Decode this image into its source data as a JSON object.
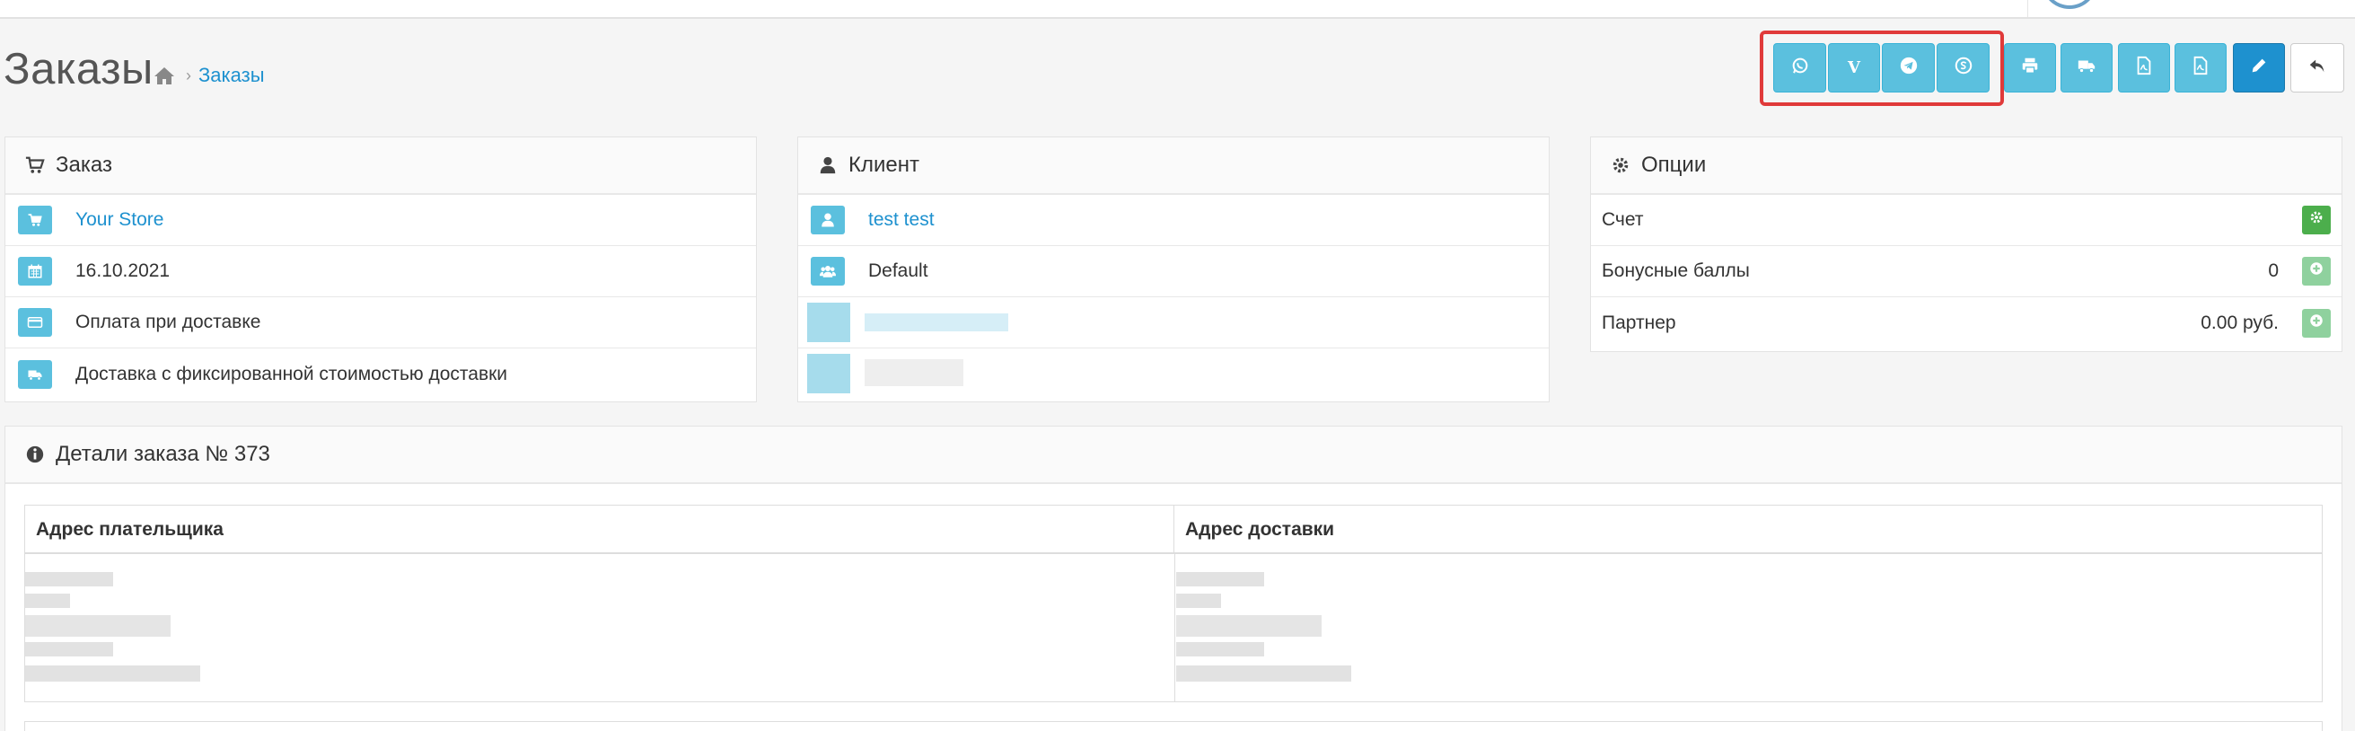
{
  "header": {
    "title": "Заказы",
    "breadcrumb": {
      "home_icon": "home-icon",
      "current": "Заказы"
    }
  },
  "toolbar": {
    "messenger_buttons": [
      {
        "name": "whatsapp-button",
        "icon": "whatsapp-icon"
      },
      {
        "name": "viber-button",
        "icon": "viber-icon",
        "glyph": "V"
      },
      {
        "name": "telegram-button",
        "icon": "telegram-icon"
      },
      {
        "name": "skype-button",
        "icon": "skype-icon"
      }
    ],
    "action_buttons": [
      {
        "name": "print-invoice-button",
        "icon": "print-icon"
      },
      {
        "name": "print-shipping-button",
        "icon": "truck-icon"
      },
      {
        "name": "pdf-invoice-button",
        "icon": "pdf-icon"
      },
      {
        "name": "pdf-shipping-button",
        "icon": "pdf-icon"
      },
      {
        "name": "edit-button",
        "icon": "pencil-icon"
      },
      {
        "name": "back-button",
        "icon": "reply-icon"
      }
    ],
    "highlight_color": "#e03a3a"
  },
  "order_panel": {
    "title": "Заказ",
    "store": "Your Store",
    "date": "16.10.2021",
    "payment": "Оплата при доставке",
    "shipping": "Доставка с фиксированной стоимостью доставки"
  },
  "customer_panel": {
    "title": "Клиент",
    "name": "test test",
    "group": "Default"
  },
  "options_panel": {
    "title": "Опции",
    "rows": [
      {
        "label": "Счет",
        "value": ""
      },
      {
        "label": "Бонусные баллы",
        "value": "0"
      },
      {
        "label": "Партнер",
        "value": "0.00 руб."
      }
    ]
  },
  "details": {
    "title": "Детали заказа № 373",
    "payment_address_header": "Адрес плательщика",
    "shipping_address_header": "Адрес доставки"
  },
  "colors": {
    "info": "#5bc0de",
    "primary": "#1e91cf",
    "success": "#4cae4c",
    "link": "#1e91cf"
  }
}
